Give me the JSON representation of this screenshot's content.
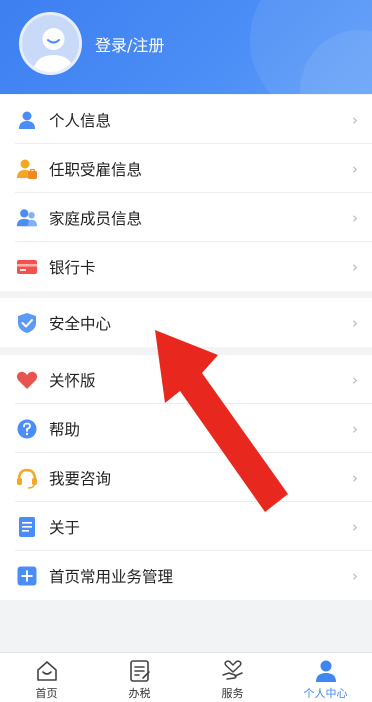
{
  "header": {
    "login_label": "登录/注册",
    "bg_color": "#4a8df6"
  },
  "menu_group_1": [
    {
      "label": "个人信息",
      "icon": "person-icon"
    },
    {
      "label": "任职受雇信息",
      "icon": "employee-icon"
    },
    {
      "label": "家庭成员信息",
      "icon": "family-icon"
    },
    {
      "label": "银行卡",
      "icon": "bank-card-icon"
    }
  ],
  "menu_group_2": [
    {
      "label": "安全中心",
      "icon": "shield-icon"
    }
  ],
  "menu_group_3": [
    {
      "label": "关怀版",
      "icon": "heart-icon"
    },
    {
      "label": "帮助",
      "icon": "question-icon"
    },
    {
      "label": "我要咨询",
      "icon": "headset-icon"
    },
    {
      "label": "关于",
      "icon": "document-icon"
    },
    {
      "label": "首页常用业务管理",
      "icon": "plus-icon"
    }
  ],
  "tabbar": [
    {
      "label": "首页",
      "icon": "home-icon"
    },
    {
      "label": "办税",
      "icon": "tax-icon"
    },
    {
      "label": "服务",
      "icon": "service-icon"
    },
    {
      "label": "个人中心",
      "icon": "profile-icon",
      "active": true
    }
  ],
  "colors": {
    "accent": "#3f86f3",
    "annotation_arrow": "#e8281e"
  }
}
